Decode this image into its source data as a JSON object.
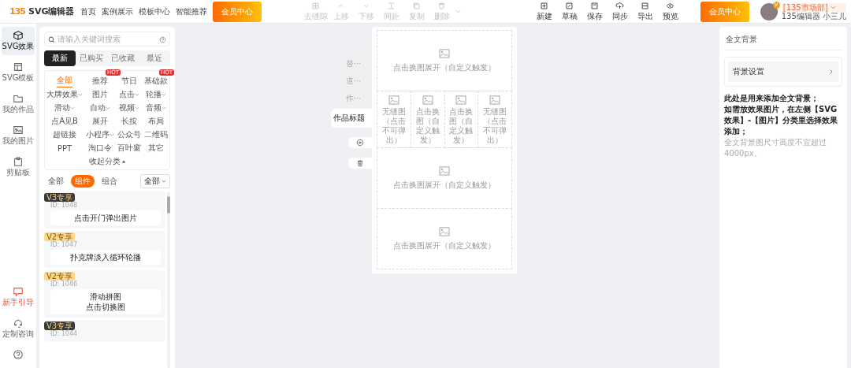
{
  "app": {
    "logo": "135",
    "title": "SVG编辑器",
    "nav": [
      "首页",
      "案例展示",
      "模板中心",
      "智能推荐"
    ],
    "vip_button": "会员中心"
  },
  "toolbar": [
    {
      "label": "去缝隙",
      "kind": "gap",
      "disabled": true
    },
    {
      "label": "上移",
      "kind": "up",
      "disabled": true
    },
    {
      "label": "下移",
      "kind": "down",
      "disabled": true
    },
    {
      "label": "间距",
      "kind": "spacing",
      "disabled": true
    },
    {
      "label": "复制",
      "kind": "copy",
      "disabled": true
    },
    {
      "label": "删除",
      "kind": "delete",
      "disabled": true
    },
    {
      "label": "新建",
      "kind": "new",
      "disabled": false
    },
    {
      "label": "草稿",
      "kind": "draft",
      "disabled": false
    },
    {
      "label": "保存",
      "kind": "save",
      "disabled": false
    },
    {
      "label": "同步",
      "kind": "sync",
      "disabled": false
    },
    {
      "label": "导出",
      "kind": "export",
      "disabled": false
    },
    {
      "label": "预览",
      "kind": "preview",
      "disabled": false
    }
  ],
  "vip_button_right": "会员中心",
  "user": {
    "team": "[135市场部]",
    "name": "135编辑器 小三儿",
    "badge": "V"
  },
  "rail": [
    {
      "label": "SVG效果",
      "kind": "cube",
      "selected": true
    },
    {
      "label": "SVG模板",
      "kind": "layout",
      "selected": false
    },
    {
      "label": "我的作品",
      "kind": "folder",
      "selected": false
    },
    {
      "label": "我的图片",
      "kind": "image",
      "selected": false
    },
    {
      "label": "剪贴板",
      "kind": "clipboard",
      "selected": false
    }
  ],
  "rail_bottom": [
    {
      "label": "新手引导",
      "kind": "guide",
      "highlight": true
    },
    {
      "label": "定制咨询",
      "kind": "headset",
      "highlight": false
    },
    {
      "kind": "help",
      "highlight": false
    }
  ],
  "library": {
    "search": {
      "placeholder": "请输入关键词搜索"
    },
    "tabs": [
      {
        "label": "最新",
        "selected": true
      },
      {
        "label": "已购买",
        "selected": false
      },
      {
        "label": "已收藏",
        "selected": false
      },
      {
        "label": "最近",
        "selected": false
      }
    ],
    "categories": [
      {
        "label": "全部",
        "selected": true,
        "dropdown": false
      },
      {
        "label": "推荐",
        "selected": false,
        "badge": "HOT",
        "dropdown": false
      },
      {
        "label": "节日",
        "selected": false,
        "dropdown": false
      },
      {
        "label": "基础款",
        "selected": false,
        "badge": "HOT",
        "dropdown": false
      },
      {
        "label": "大牌效果",
        "selected": false,
        "dropdown": true
      },
      {
        "label": "图片",
        "selected": false,
        "dropdown": false
      },
      {
        "label": "点击",
        "selected": false,
        "dropdown": true
      },
      {
        "label": "轮播",
        "selected": false,
        "dropdown": true
      },
      {
        "label": "滑动",
        "selected": false,
        "dropdown": true
      },
      {
        "label": "自动",
        "selected": false,
        "dropdown": true
      },
      {
        "label": "视频",
        "selected": false,
        "dropdown": true
      },
      {
        "label": "音频",
        "selected": false,
        "dropdown": true
      },
      {
        "label": "点A见B",
        "selected": false,
        "dropdown": false
      },
      {
        "label": "展开",
        "selected": false,
        "dropdown": false
      },
      {
        "label": "长按",
        "selected": false,
        "dropdown": false
      },
      {
        "label": "布局",
        "selected": false,
        "dropdown": false
      },
      {
        "label": "超链接",
        "selected": false,
        "dropdown": false
      },
      {
        "label": "小程序",
        "selected": false,
        "dropdown": true
      },
      {
        "label": "公众号",
        "selected": false,
        "dropdown": false
      },
      {
        "label": "二维码",
        "selected": false,
        "dropdown": false
      },
      {
        "label": "PPT",
        "selected": false,
        "dropdown": false
      },
      {
        "label": "淘口令",
        "selected": false,
        "dropdown": false
      },
      {
        "label": "百叶窗",
        "selected": false,
        "dropdown": false
      },
      {
        "label": "其它",
        "selected": false,
        "dropdown": false
      }
    ],
    "collapse": "收起分类",
    "filters": [
      {
        "label": "全部",
        "selected": false
      },
      {
        "label": "组件",
        "selected": true
      },
      {
        "label": "组合",
        "selected": false
      }
    ],
    "filter_select": "全部",
    "cards": [
      {
        "badge": "V3专享",
        "kind": "dark",
        "id": "ID: 1048",
        "title": [
          "点击开门弹出图片"
        ]
      },
      {
        "badge": "V2专享",
        "kind": "light",
        "id": "ID: 1047",
        "title": [
          "扑克牌淡入循环轮播"
        ]
      },
      {
        "badge": "V2专享",
        "kind": "light",
        "id": "ID: 1046",
        "title": [
          "滑动拼图",
          "点击切换图"
        ]
      },
      {
        "badge": "V3专享",
        "kind": "dark",
        "id": "ID: 1044"
      }
    ]
  },
  "editor": {
    "side_tabs": [
      {
        "label": "替···",
        "selected": false
      },
      {
        "label": "道···",
        "selected": false
      },
      {
        "label": "作···",
        "selected": false
      },
      {
        "label": "作品标题",
        "selected": true
      }
    ],
    "blocks": [
      {
        "kind": "wide",
        "text": "点击换图展开（自定义触发）"
      },
      {
        "kind": "cells",
        "cells": [
          "无缝图（点击不可弹出）",
          "点击换图（自定义触发）",
          "点击换图（自定义触发）",
          "无缝图（点击不可弹出）"
        ]
      },
      {
        "kind": "wide",
        "text": "点击换图展开（自定义触发）"
      },
      {
        "kind": "wide",
        "text": "点击换图展开（自定义触发）"
      }
    ]
  },
  "background_panel": {
    "title": "全文背景",
    "setting": "背景设置",
    "notes": [
      {
        "kind": "strong",
        "text": "此处是用来添加全文背景；"
      },
      {
        "kind": "strong",
        "text": "如需放效果图片，在左侧【SVG效果】-【图片】分类里选择效果添加；"
      },
      {
        "kind": "hint",
        "text": "全文背景图尺寸高度不宜超过4000px。"
      }
    ]
  }
}
